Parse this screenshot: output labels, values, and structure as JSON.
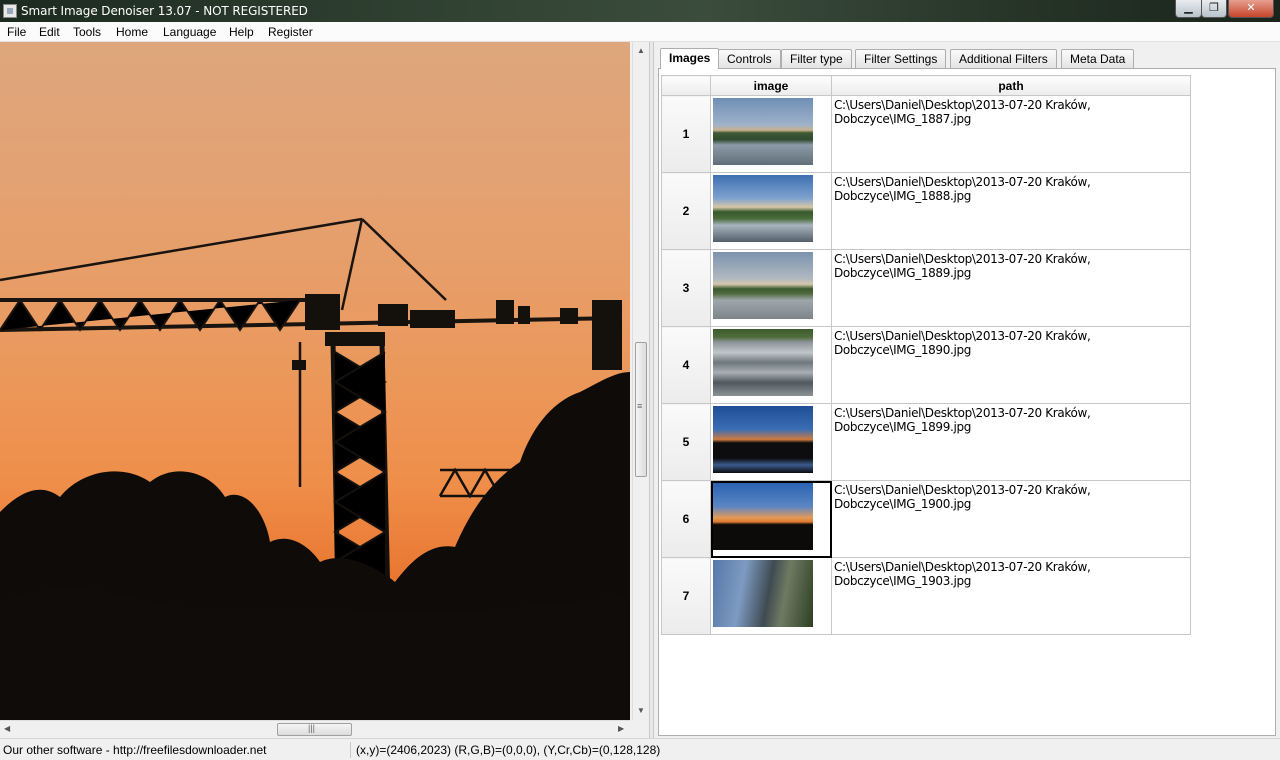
{
  "window": {
    "title": "Smart Image Denoiser 13.07 - NOT REGISTERED",
    "minimize_glyph": "▁",
    "maximize_glyph": "❐",
    "close_glyph": "✕"
  },
  "menu": [
    "File",
    "Edit",
    "Tools",
    "Home",
    "Language",
    "Help",
    "Register"
  ],
  "scrollbars": {
    "up": "▲",
    "down": "▼",
    "left": "◀",
    "right": "▶",
    "grip_v": "≡",
    "grip_h": "|||"
  },
  "tabs": [
    {
      "label": "Images",
      "active": true
    },
    {
      "label": "Controls",
      "active": false
    },
    {
      "label": "Filter type",
      "active": false
    },
    {
      "label": "Filter Settings",
      "active": false
    },
    {
      "label": "Additional Filters",
      "active": false
    },
    {
      "label": "Meta Data",
      "active": false
    }
  ],
  "table": {
    "headers": [
      "",
      "image",
      "path"
    ],
    "rows": [
      {
        "num": "1",
        "path": "C:\\Users\\Daniel\\Desktop\\2013-07-20 Kraków, Dobczyce\\IMG_1887.jpg",
        "selected": false
      },
      {
        "num": "2",
        "path": "C:\\Users\\Daniel\\Desktop\\2013-07-20 Kraków, Dobczyce\\IMG_1888.jpg",
        "selected": false
      },
      {
        "num": "3",
        "path": "C:\\Users\\Daniel\\Desktop\\2013-07-20 Kraków, Dobczyce\\IMG_1889.jpg",
        "selected": false
      },
      {
        "num": "4",
        "path": "C:\\Users\\Daniel\\Desktop\\2013-07-20 Kraków, Dobczyce\\IMG_1890.jpg",
        "selected": false
      },
      {
        "num": "5",
        "path": "C:\\Users\\Daniel\\Desktop\\2013-07-20 Kraków, Dobczyce\\IMG_1899.jpg",
        "selected": false
      },
      {
        "num": "6",
        "path": "C:\\Users\\Daniel\\Desktop\\2013-07-20 Kraków, Dobczyce\\IMG_1900.jpg",
        "selected": true
      },
      {
        "num": "7",
        "path": "C:\\Users\\Daniel\\Desktop\\2013-07-20 Kraków, Dobczyce\\IMG_1903.jpg",
        "selected": false
      }
    ]
  },
  "status": {
    "left": "Our other software - http://freefilesdownloader.net",
    "right": "(x,y)=(2406,2023) (R,G,B)=(0,0,0), (Y,Cr,Cb)=(0,128,128)"
  }
}
